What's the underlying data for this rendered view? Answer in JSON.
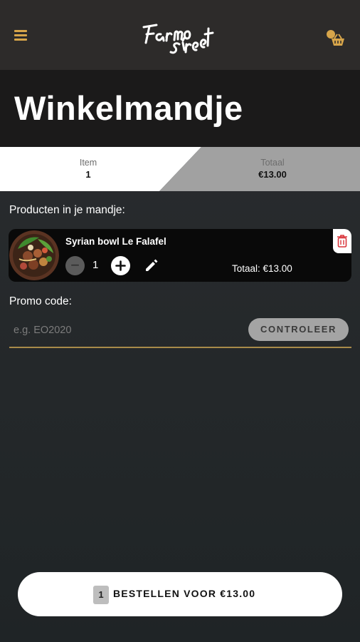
{
  "app": {
    "logo_text": "Farmo Street"
  },
  "page": {
    "title": "Winkelmandje"
  },
  "summary": {
    "item_label": "Item",
    "item_value": "1",
    "total_label": "Totaal",
    "total_value": "€13.00"
  },
  "cart": {
    "section_label": "Producten in je mandje:",
    "items": [
      {
        "name": "Syrian bowl Le Falafel",
        "quantity": "1",
        "minus_symbol": "−",
        "total": "Totaal: €13.00"
      }
    ]
  },
  "promo": {
    "label": "Promo code:",
    "placeholder": "e.g. EO2020",
    "button_label": "CONTROLEER"
  },
  "order_button": {
    "count": "1",
    "label": "BESTELLEN VOOR €13.00"
  },
  "colors": {
    "accent": "#d7a54a",
    "header_bg": "#2d2b2a",
    "hero_bg": "#1b1a1a",
    "promo_underline": "#a88a49",
    "delete_red": "#d9343a"
  },
  "icons": [
    "menu-icon",
    "basket-icon",
    "trash-icon",
    "plus-icon",
    "minus-icon",
    "pencil-icon"
  ]
}
